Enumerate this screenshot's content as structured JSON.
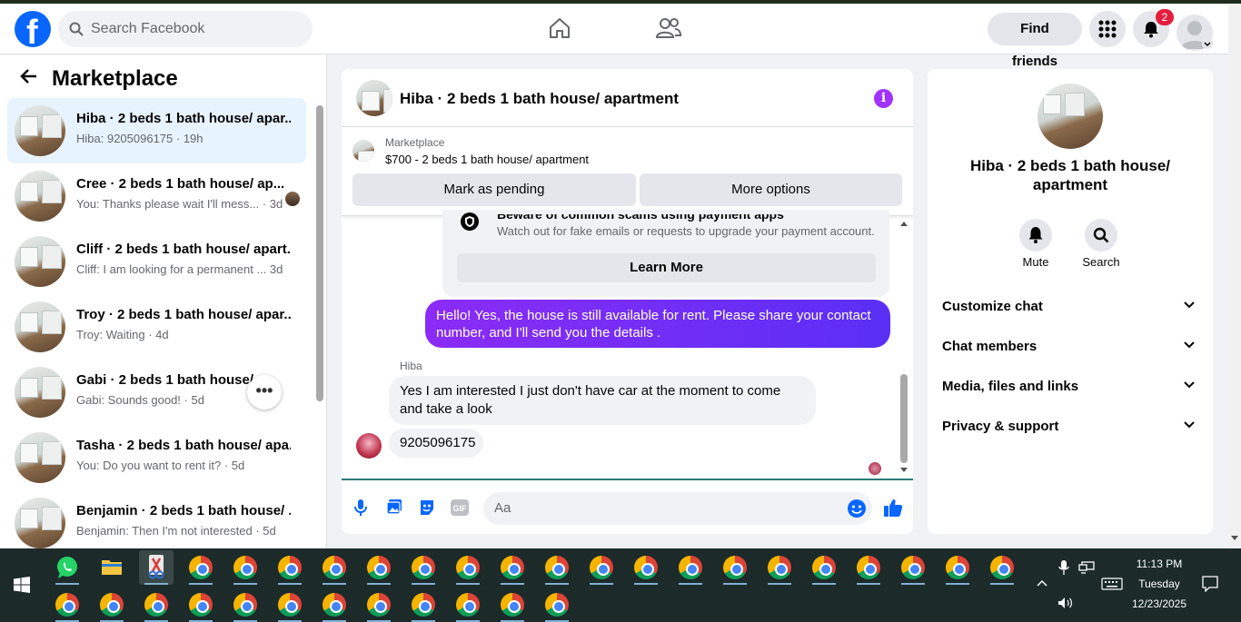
{
  "topbar": {
    "logo": "f",
    "search_placeholder": "Search Facebook",
    "find_friends": "Find friends",
    "notifications_count": "2",
    "icons": [
      "home-icon",
      "friends-icon",
      "menu-grid-icon",
      "bell-icon",
      "profile-avatar"
    ]
  },
  "sidebar": {
    "title": "Marketplace",
    "threads": [
      {
        "name": "Hiba · 2 beds 1 bath house/ apar...",
        "preview": "Hiba: 9205096175 · 19h",
        "selected": true
      },
      {
        "name": "Cree · 2 beds 1 bath house/ ap...",
        "preview": "You: Thanks please wait I'll mess... · 3d"
      },
      {
        "name": "Cliff · 2 beds 1 bath house/ apart...",
        "preview": "Cliff: I am looking for a permanent ...  3d"
      },
      {
        "name": "Troy · 2 beds 1 bath house/ apar...",
        "preview": "Troy: Waiting · 4d"
      },
      {
        "name": "Gabi · 2 beds 1 bath house/ a...",
        "preview": "Gabi: Sounds good! · 5d"
      },
      {
        "name": "Tasha · 2 beds 1 bath house/ apa...",
        "preview": "You: Do you want to rent it? · 5d"
      },
      {
        "name": "Benjamin · 2 beds 1 bath house/ ...",
        "preview": "Benjamin: Then I'm not interested · 5d"
      }
    ],
    "more": "•••"
  },
  "chat": {
    "title": "Hiba · 2 beds 1 bath house/ apartment",
    "info": "i",
    "marketplace_label": "Marketplace",
    "listing": "$700 - 2 beds 1 bath house/ apartment",
    "mark_pending": "Mark as pending",
    "more_options": "More options",
    "warning_title": "Beware of common scams using payment apps",
    "warning_sub": "Watch out for fake emails or requests to upgrade your payment account.",
    "learn_more": "Learn More",
    "outgoing": "Hello! Yes, the house is still available for rent. Please share your contact number, and I'll send you the details .",
    "sender_label": "Hiba",
    "incoming1": "Yes I am interested I just don't have car at the moment to come and take a look",
    "incoming2": "9205096175",
    "composer_placeholder": "Aa"
  },
  "details": {
    "name": "Hiba · 2 beds 1 bath house/ apartment",
    "mute": "Mute",
    "search": "Search",
    "rows": [
      "Customize chat",
      "Chat members",
      "Media, files and links",
      "Privacy & support"
    ]
  },
  "taskbar": {
    "time": "11:13 PM",
    "day": "Tuesday",
    "date": "12/23/2025"
  },
  "colors": {
    "brand": "#0866ff",
    "outgoing_bubble": "#7b2ff7",
    "badge": "#e41e3f"
  }
}
